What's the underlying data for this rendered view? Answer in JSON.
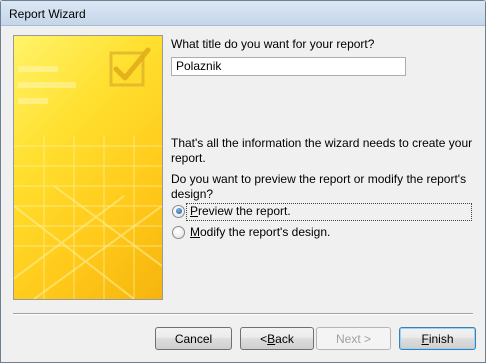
{
  "window": {
    "title": "Report Wizard"
  },
  "form": {
    "title_prompt": "What title do you want for your report?",
    "title_value": "Polaznik",
    "info_line1": "That's all the information the wizard needs to create your",
    "info_line2": "report.",
    "preview_question_line1": "Do you want to preview the report or modify the report's",
    "preview_question_line2": "design?",
    "options": [
      {
        "prefix": "",
        "accel": "P",
        "rest": "review the report.",
        "selected": true
      },
      {
        "prefix": "",
        "accel": "M",
        "rest": "odify the report's design.",
        "selected": false
      }
    ]
  },
  "buttons": {
    "cancel": "Cancel",
    "back_prefix": "< ",
    "back_accel": "B",
    "back_rest": "ack",
    "next": "Next >",
    "finish_accel": "F",
    "finish_rest": "inish"
  },
  "colors": {
    "art_yellow": "#ffd72a",
    "accent_blue": "#3c7fb1"
  },
  "icons": {
    "art": "checkmark-report-icon"
  }
}
